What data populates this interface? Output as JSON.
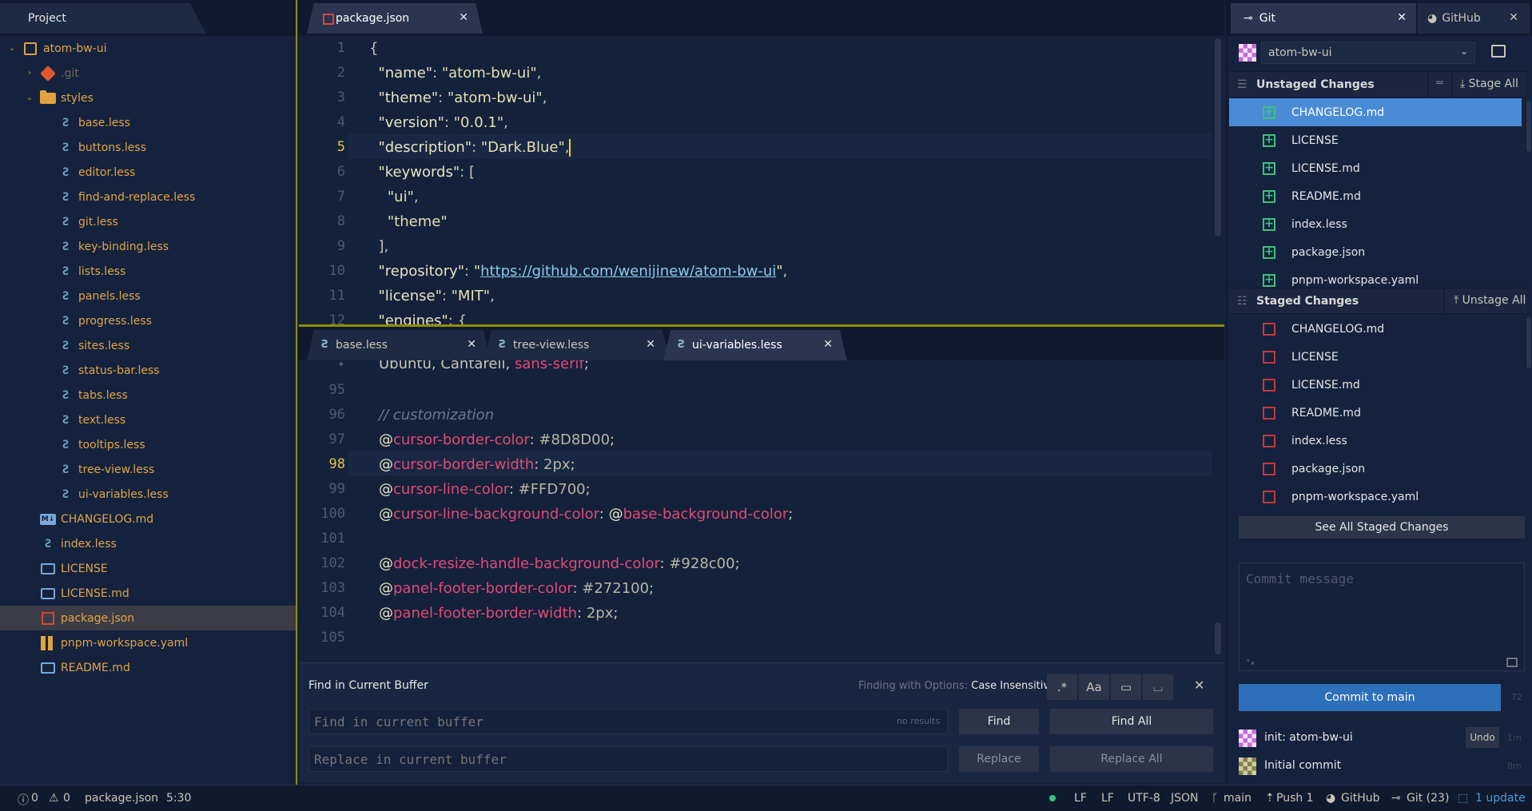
{
  "colors": {
    "accent": "#928c00",
    "cursor": "#FFD700",
    "selection": "#4a8bd6",
    "added": "#3ec17b",
    "modified": "#c23a3a",
    "commit_button": "#2d6fb8"
  },
  "tree": {
    "tab_label": "Project",
    "items": [
      {
        "label": "atom-bw-ui",
        "icon": "book-icon"
      },
      {
        "label": ".git",
        "icon": "git-icon"
      },
      {
        "label": "styles",
        "icon": "folder-icon"
      },
      {
        "label": "base.less",
        "icon": "less-file-icon"
      },
      {
        "label": "buttons.less",
        "icon": "less-file-icon"
      },
      {
        "label": "editor.less",
        "icon": "less-file-icon"
      },
      {
        "label": "find-and-replace.less",
        "icon": "less-file-icon"
      },
      {
        "label": "git.less",
        "icon": "less-file-icon"
      },
      {
        "label": "key-binding.less",
        "icon": "less-file-icon"
      },
      {
        "label": "lists.less",
        "icon": "less-file-icon"
      },
      {
        "label": "panels.less",
        "icon": "less-file-icon"
      },
      {
        "label": "progress.less",
        "icon": "less-file-icon"
      },
      {
        "label": "sites.less",
        "icon": "less-file-icon"
      },
      {
        "label": "status-bar.less",
        "icon": "less-file-icon"
      },
      {
        "label": "tabs.less",
        "icon": "less-file-icon"
      },
      {
        "label": "text.less",
        "icon": "less-file-icon"
      },
      {
        "label": "tooltips.less",
        "icon": "less-file-icon"
      },
      {
        "label": "tree-view.less",
        "icon": "less-file-icon"
      },
      {
        "label": "ui-variables.less",
        "icon": "less-file-icon"
      },
      {
        "label": "CHANGELOG.md",
        "icon": "markdown-icon"
      },
      {
        "label": "index.less",
        "icon": "less-file-icon"
      },
      {
        "label": "LICENSE",
        "icon": "license-icon"
      },
      {
        "label": "LICENSE.md",
        "icon": "license-icon"
      },
      {
        "label": "package.json",
        "icon": "npm-icon"
      },
      {
        "label": "pnpm-workspace.yaml",
        "icon": "yaml-icon"
      },
      {
        "label": "README.md",
        "icon": "license-icon"
      }
    ]
  },
  "top_editor": {
    "tab_label": "package.json",
    "line_numbers": [
      "1",
      "2",
      "3",
      "4",
      "5",
      "6",
      "7",
      "8",
      "9",
      "10",
      "11",
      "12"
    ],
    "current_line": "5"
  },
  "bottom_editor": {
    "tabs": [
      {
        "label": "base.less"
      },
      {
        "label": "tree-view.less"
      },
      {
        "label": "ui-variables.less"
      }
    ],
    "line_numbers": [
      "•",
      "95",
      "96",
      "97",
      "98",
      "99",
      "100",
      "101",
      "102",
      "103",
      "104",
      "105"
    ],
    "current_line": "98"
  },
  "find": {
    "title": "Find in Current Buffer",
    "options_prefix": "Finding with Options:",
    "options_value": "Case Insensitive",
    "find_placeholder": "Find in current buffer",
    "replace_placeholder": "Replace in current buffer",
    "results": "no results",
    "find_label": "Find",
    "find_all_label": "Find All",
    "replace_label": "Replace",
    "replace_all_label": "Replace All",
    "regex_icon": ".*",
    "case_icon": "Aa"
  },
  "git": {
    "tab_git": "Git",
    "tab_github": "GitHub",
    "repo": "atom-bw-ui",
    "unstaged_title": "Unstaged Changes",
    "stage_all": "Stage All",
    "unstaged": [
      "CHANGELOG.md",
      "LICENSE",
      "LICENSE.md",
      "README.md",
      "index.less",
      "package.json",
      "pnpm-workspace.yaml"
    ],
    "staged_title": "Staged Changes",
    "unstage_all": "Unstage All",
    "staged": [
      "CHANGELOG.md",
      "LICENSE",
      "LICENSE.md",
      "README.md",
      "index.less",
      "package.json",
      "pnpm-workspace.yaml"
    ],
    "see_all": "See All Staged Changes",
    "commit_placeholder": "Commit message",
    "commit_button": "Commit to main",
    "char_count": "72",
    "commits": [
      {
        "message": "init: atom-bw-ui",
        "action": "Undo",
        "age": "1m"
      },
      {
        "message": "Initial commit",
        "age": "8m"
      }
    ]
  },
  "status": {
    "errors": "0",
    "warnings": "0",
    "file": "package.json",
    "position": "5:30",
    "eol1": "LF",
    "eol2": "LF",
    "encoding": "UTF-8",
    "grammar": "JSON",
    "branch": "main",
    "push": "Push 1",
    "github": "GitHub",
    "git": "Git (23)",
    "update": "1 update"
  }
}
